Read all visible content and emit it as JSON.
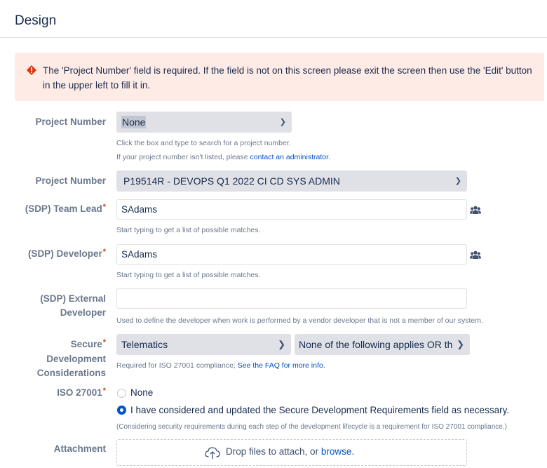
{
  "page": {
    "title": "Design"
  },
  "error": {
    "message": "The 'Project Number' field is required. If the field is not on this screen please exit the screen then use the 'Edit' button in the upper left to fill it in."
  },
  "fields": {
    "project_number_1": {
      "label": "Project Number",
      "value": "None",
      "help1": "Click the box and type to search for a project number.",
      "help2_prefix": "If your project number isn't listed, please ",
      "help2_link": "contact an administrator",
      "help2_suffix": "."
    },
    "project_number_2": {
      "label": "Project Number",
      "value": "P19514R - DEVOPS Q1 2022 CI CD SYS ADMIN"
    },
    "team_lead": {
      "label": "(SDP) Team Lead",
      "required": "*",
      "value": "SAdams",
      "help": "Start typing to get a list of possible matches."
    },
    "developer": {
      "label": "(SDP) Developer",
      "required": "*",
      "value": "SAdams",
      "help": "Start typing to get a list of possible matches."
    },
    "external_developer": {
      "label_line1": "(SDP) External",
      "label_line2": "Developer",
      "value": "",
      "help": "Used to define the developer when work is performed by a vendor developer that is not a member of our system."
    },
    "secure_dev": {
      "label_line1": "Secure",
      "required": "*",
      "label_line2": "Development",
      "label_line3": "Considerations",
      "value1": "Telematics",
      "value2": "None of the following applies OR th",
      "help_prefix": "Required for ISO 27001 compliance; ",
      "help_link": "See the FAQ for more info."
    },
    "iso": {
      "label": "ISO 27001",
      "required": "*",
      "options": [
        {
          "label": "None",
          "selected": false
        },
        {
          "label": "I have considered and updated the Secure Development Requirements field as necessary.",
          "selected": true
        }
      ],
      "help": "(Considering security requirements during each step of the development lifecycle is a requirement for ISO 27001 compliance.)"
    },
    "attachment": {
      "label": "Attachment",
      "drop_text": "Drop files to attach, or ",
      "browse_link": "browse."
    }
  },
  "colors": {
    "error_bg": "#ffebe6",
    "error_icon": "#de350b",
    "link": "#0052cc",
    "select_bg": "#dfe1e6",
    "label": "#6b778c"
  }
}
